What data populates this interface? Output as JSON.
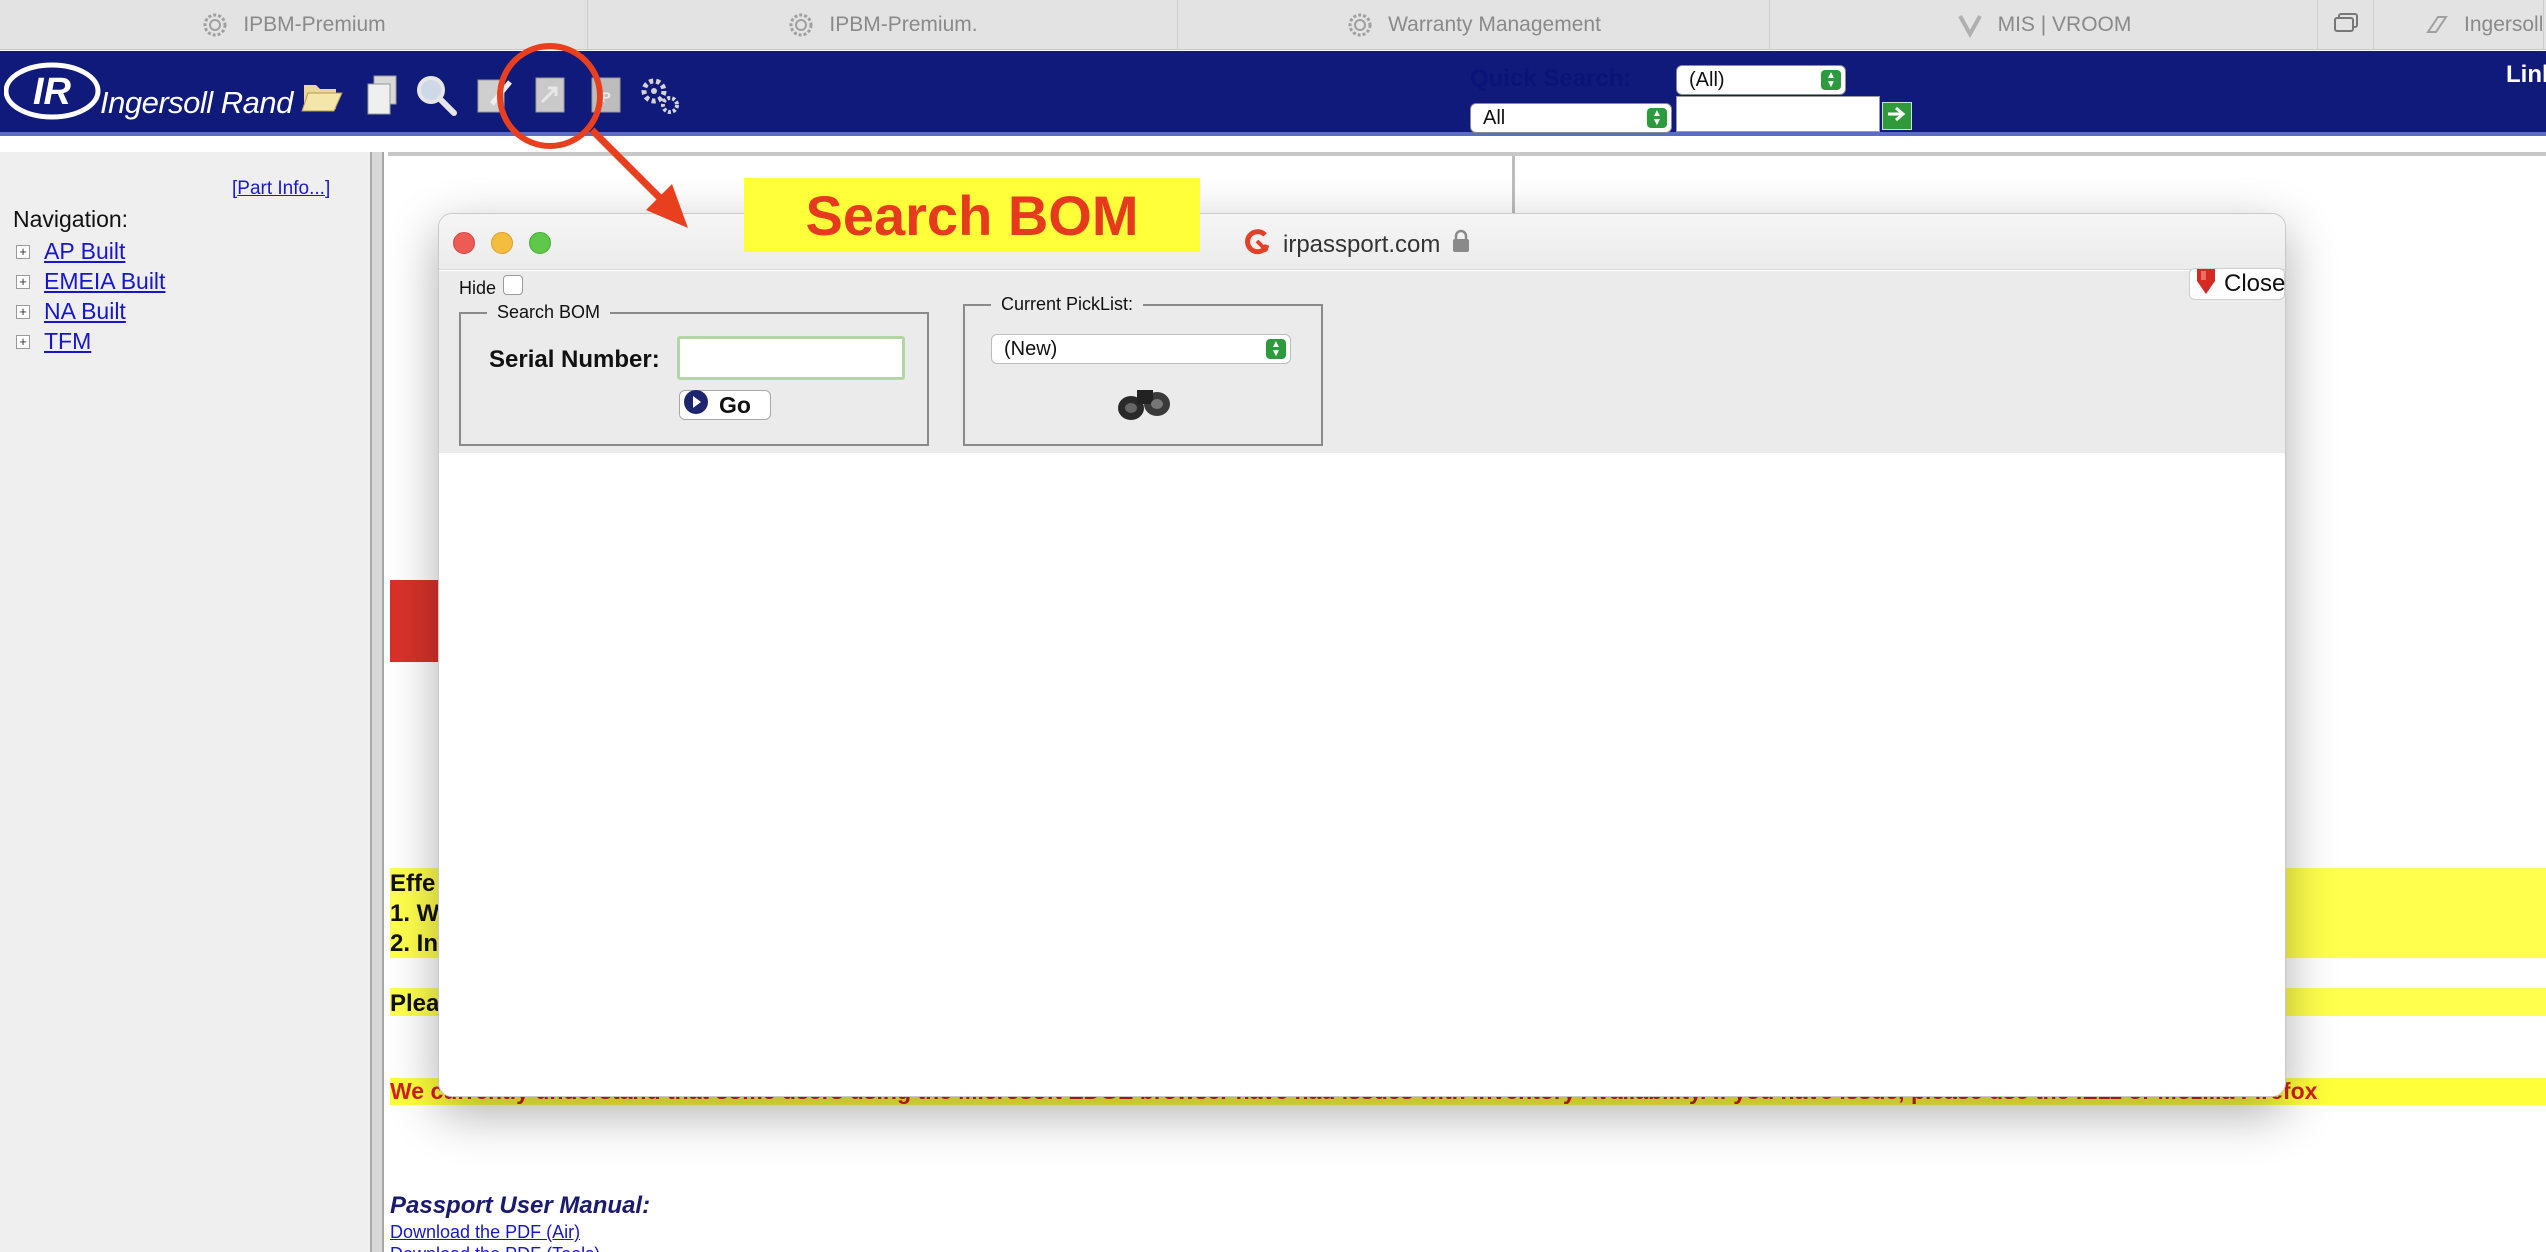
{
  "browser": {
    "tabs": [
      {
        "title": "IPBM-Premium"
      },
      {
        "title": "IPBM-Premium."
      },
      {
        "title": "Warranty Management"
      },
      {
        "title": "MIS | VROOM"
      },
      {
        "title": "IngersollF"
      }
    ]
  },
  "header": {
    "logo_mark": "IR",
    "logo_text": "Ingersoll Rand",
    "quick_search_label": "Quick Search:",
    "quick_search_select": "(All)",
    "quick_search_scope": "All",
    "quick_search_value": "",
    "link_label": "Linl",
    "colors": {
      "header_bg": "#0f1a7a",
      "go_green": "#2f9a3a"
    }
  },
  "sidebar": {
    "part_info_prefix": "[",
    "part_info_link": "Part Info...",
    "part_info_suffix": "]",
    "nav_title": "Navigation:",
    "items": [
      {
        "label": "AP Built"
      },
      {
        "label": "EMEIA Built"
      },
      {
        "label": "NA Built"
      },
      {
        "label": "TFM"
      }
    ]
  },
  "main": {
    "bg_lines": [
      "Effe",
      "1. W",
      "2. In",
      "Plea"
    ],
    "warning": "We currently understand that some users using the Microsoft EDGE browser have had issues with Inventory Availability. If you have issue, please use the IE11 or Mozilla Firefox",
    "manual_title": "Passport User Manual:",
    "manual_links": [
      "Download the PDF (Air)",
      "Download the PDF (Tools)"
    ]
  },
  "modal": {
    "url": "irpassport.com",
    "hide_label": "Hide",
    "close_label": "Close",
    "search_bom_legend": "Search BOM",
    "serial_label": "Serial Number:",
    "serial_value": "",
    "go_label": "Go",
    "picklist_legend": "Current PickList:",
    "picklist_value": "(New)"
  },
  "annotation": {
    "callout_text": "Search BOM",
    "colors": {
      "callout_bg": "#ffff3a",
      "callout_text": "#e63a1e",
      "circle": "#e8401e"
    }
  }
}
